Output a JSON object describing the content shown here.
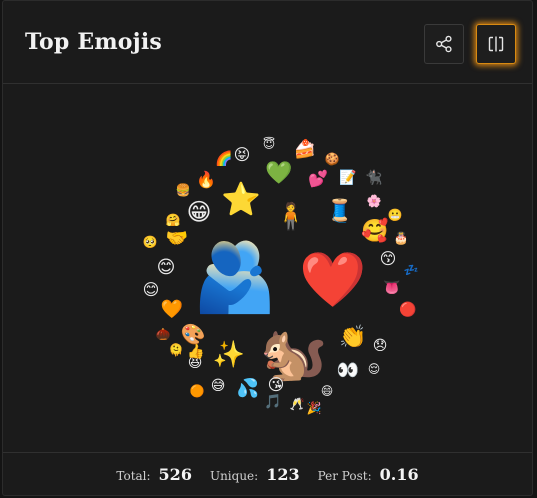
{
  "header": {
    "title": "Top Emojis",
    "share_icon": "share-icon",
    "split_icon": "split-view-icon",
    "accent_color": "#e8901a"
  },
  "emojis": [
    {
      "char": "🫂",
      "rank": 1
    },
    {
      "char": "❤️",
      "rank": 2
    },
    {
      "char": "🐿️",
      "rank": 3
    },
    {
      "char": "⭐",
      "rank": 4
    },
    {
      "char": "😁",
      "rank": 5
    },
    {
      "char": "🥰",
      "rank": 6
    },
    {
      "char": "😊",
      "rank": 7
    },
    {
      "char": "👏",
      "rank": 8
    },
    {
      "char": "🎨",
      "rank": 9
    },
    {
      "char": "✨",
      "rank": 10
    },
    {
      "char": "🧵",
      "rank": 11
    },
    {
      "char": "💚",
      "rank": 12
    },
    {
      "char": "🧍",
      "rank": 13
    },
    {
      "char": "😙",
      "rank": 14
    },
    {
      "char": "👀",
      "rank": 15
    },
    {
      "char": "😊",
      "rank": 16
    },
    {
      "char": "🧡",
      "rank": 17
    },
    {
      "char": "🤝",
      "rank": 18
    },
    {
      "char": "😘",
      "rank": 19
    },
    {
      "char": "💦",
      "rank": 20
    },
    {
      "char": "🍰",
      "rank": 21
    },
    {
      "char": "💕",
      "rank": 22
    },
    {
      "char": "😞",
      "rank": 23
    },
    {
      "char": "😝",
      "rank": 24
    },
    {
      "char": "🔥",
      "rank": 25
    },
    {
      "char": "🌈",
      "rank": 26
    },
    {
      "char": "🍔",
      "rank": 27
    },
    {
      "char": "😆",
      "rank": 28
    },
    {
      "char": "😅",
      "rank": 29
    },
    {
      "char": "😌",
      "rank": 30
    },
    {
      "char": "👍",
      "rank": 31
    },
    {
      "char": "🎵",
      "rank": 32
    },
    {
      "char": "😄",
      "rank": 33
    },
    {
      "char": "🍪",
      "rank": 34
    },
    {
      "char": "📝",
      "rank": 35
    },
    {
      "char": "🐈‍⬛",
      "rank": 36
    },
    {
      "char": "🌸",
      "rank": 37
    },
    {
      "char": "🎂",
      "rank": 38
    },
    {
      "char": "💤",
      "rank": 39
    },
    {
      "char": "👅",
      "rank": 40
    },
    {
      "char": "🔴",
      "rank": 41
    },
    {
      "char": "🌰",
      "rank": 42
    },
    {
      "char": "🟠",
      "rank": 43
    },
    {
      "char": "🥂",
      "rank": 44
    },
    {
      "char": "🎉",
      "rank": 45
    },
    {
      "char": "😬",
      "rank": 46
    },
    {
      "char": "😇",
      "rank": 47
    },
    {
      "char": "🥺",
      "rank": 48
    },
    {
      "char": "🤗",
      "rank": 49
    },
    {
      "char": "🫠",
      "rank": 50
    }
  ],
  "footer": {
    "total_label": "Total:",
    "total_value": "526",
    "unique_label": "Unique:",
    "unique_value": "123",
    "per_post_label": "Per Post:",
    "per_post_value": "0.16"
  }
}
